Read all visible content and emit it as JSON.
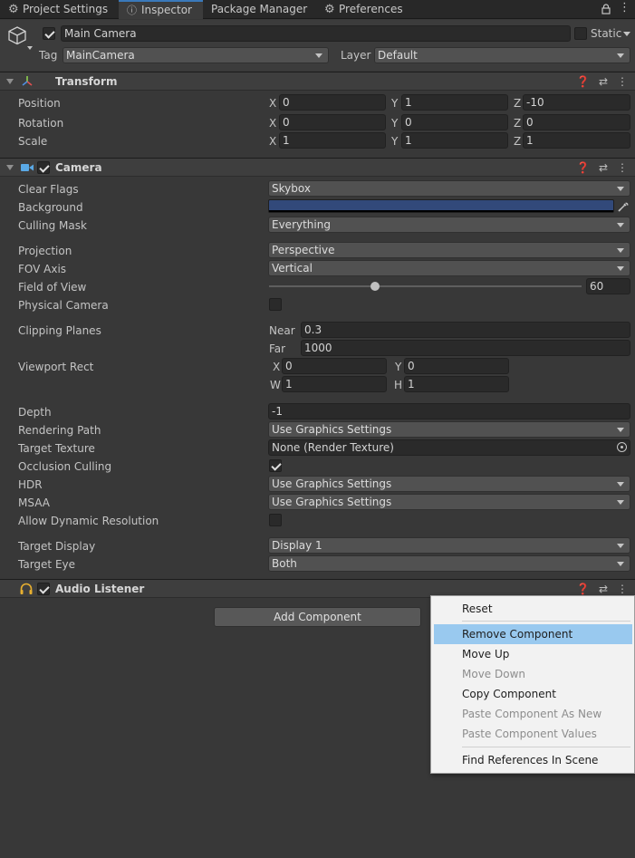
{
  "tabs": [
    {
      "label": "Project Settings",
      "icon": "gear-icon"
    },
    {
      "label": "Inspector",
      "icon": "info-icon"
    },
    {
      "label": "Package Manager",
      "icon": ""
    },
    {
      "label": "Preferences",
      "icon": "gear-icon"
    }
  ],
  "gameobject": {
    "name": "Main Camera",
    "static_label": "Static",
    "tag_label": "Tag",
    "tag": "MainCamera",
    "layer_label": "Layer",
    "layer": "Default"
  },
  "transform": {
    "title": "Transform",
    "position_label": "Position",
    "rotation_label": "Rotation",
    "scale_label": "Scale",
    "axis_x": "X",
    "axis_y": "Y",
    "axis_z": "Z",
    "position": {
      "x": "0",
      "y": "1",
      "z": "-10"
    },
    "rotation": {
      "x": "0",
      "y": "0",
      "z": "0"
    },
    "scale": {
      "x": "1",
      "y": "1",
      "z": "1"
    }
  },
  "camera": {
    "title": "Camera",
    "clear_flags_label": "Clear Flags",
    "clear_flags": "Skybox",
    "background_label": "Background",
    "background_color": "#32497a",
    "culling_mask_label": "Culling Mask",
    "culling_mask": "Everything",
    "projection_label": "Projection",
    "projection": "Perspective",
    "fov_axis_label": "FOV Axis",
    "fov_axis": "Vertical",
    "fov_label": "Field of View",
    "fov": "60",
    "physical_camera_label": "Physical Camera",
    "clipping_label": "Clipping Planes",
    "near_label": "Near",
    "near": "0.3",
    "far_label": "Far",
    "far": "1000",
    "viewport_label": "Viewport Rect",
    "vp_x_label": "X",
    "vp_x": "0",
    "vp_y_label": "Y",
    "vp_y": "0",
    "vp_w_label": "W",
    "vp_w": "1",
    "vp_h_label": "H",
    "vp_h": "1",
    "depth_label": "Depth",
    "depth": "-1",
    "rendering_path_label": "Rendering Path",
    "rendering_path": "Use Graphics Settings",
    "target_texture_label": "Target Texture",
    "target_texture": "None (Render Texture)",
    "occlusion_label": "Occlusion Culling",
    "hdr_label": "HDR",
    "hdr": "Use Graphics Settings",
    "msaa_label": "MSAA",
    "msaa": "Use Graphics Settings",
    "dynres_label": "Allow Dynamic Resolution",
    "target_display_label": "Target Display",
    "target_display": "Display 1",
    "target_eye_label": "Target Eye",
    "target_eye": "Both"
  },
  "audio_listener": {
    "title": "Audio Listener"
  },
  "add_component_label": "Add Component",
  "context_menu": {
    "reset": "Reset",
    "remove": "Remove Component",
    "move_up": "Move Up",
    "move_down": "Move Down",
    "copy": "Copy Component",
    "paste_new": "Paste Component As New",
    "paste_values": "Paste Component Values",
    "find_refs": "Find References In Scene"
  }
}
